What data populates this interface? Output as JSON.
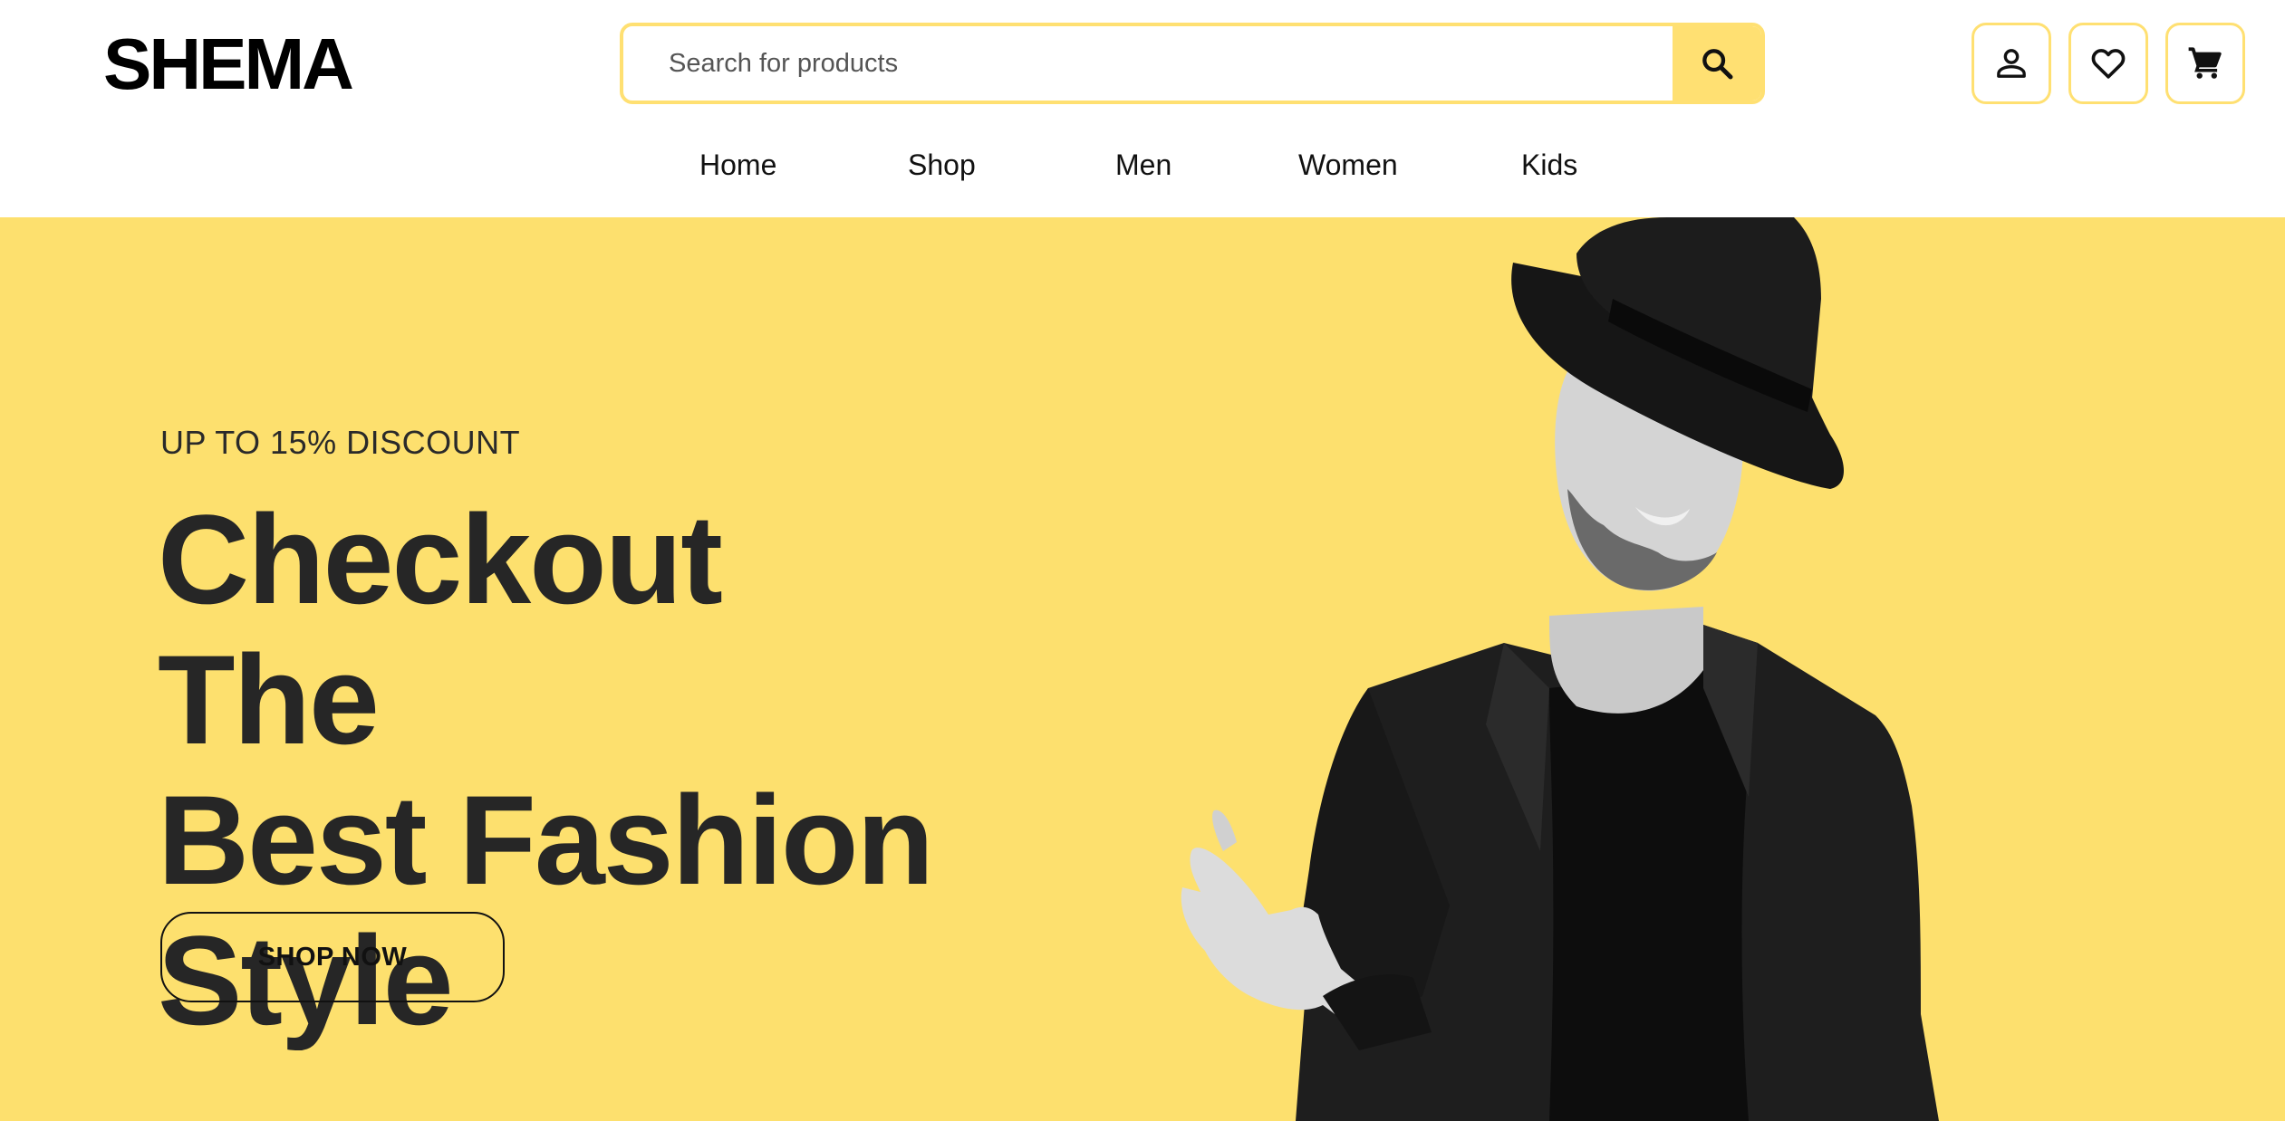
{
  "brand": {
    "logo": "SHEMA"
  },
  "search": {
    "placeholder": "Search for products"
  },
  "header_icons": [
    "user-icon",
    "heart-icon",
    "cart-icon"
  ],
  "nav": {
    "items": [
      "Home",
      "Shop",
      "Men",
      "Women",
      "Kids"
    ]
  },
  "hero": {
    "discount": "UP TO 15% DISCOUNT",
    "title_lines": [
      "Checkout The",
      "Best Fashion",
      "Style"
    ],
    "cta": "SHOP NOW"
  },
  "colors": {
    "accent": "#fde06e",
    "border_accent": "#ffe072",
    "text_dark": "#262626"
  }
}
